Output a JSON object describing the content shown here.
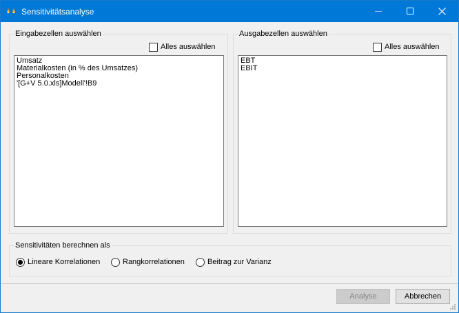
{
  "window": {
    "title": "Sensitivitätsanalyse",
    "accent": "#0078d7"
  },
  "input_group": {
    "title": "Eingabezellen auswählen",
    "select_all_label": "Alles auswählen",
    "select_all_checked": false,
    "items": [
      "Umsatz",
      "Materialkosten (in % des Umsatzes)",
      "Personalkosten",
      "'[G+V 5.0.xls]Modell'!B9"
    ]
  },
  "output_group": {
    "title": "Ausgabezellen auswählen",
    "select_all_label": "Alles auswählen",
    "select_all_checked": false,
    "items": [
      "EBT",
      "EBIT"
    ]
  },
  "calc_group": {
    "title": "Sensitivitäten berechnen als",
    "options": [
      {
        "label": "Lineare Korrelationen",
        "selected": true
      },
      {
        "label": "Rangkorrelationen",
        "selected": false
      },
      {
        "label": "Beitrag zur Varianz",
        "selected": false
      }
    ]
  },
  "buttons": {
    "analyze_label": "Analyse",
    "analyze_enabled": false,
    "cancel_label": "Abbrechen"
  }
}
